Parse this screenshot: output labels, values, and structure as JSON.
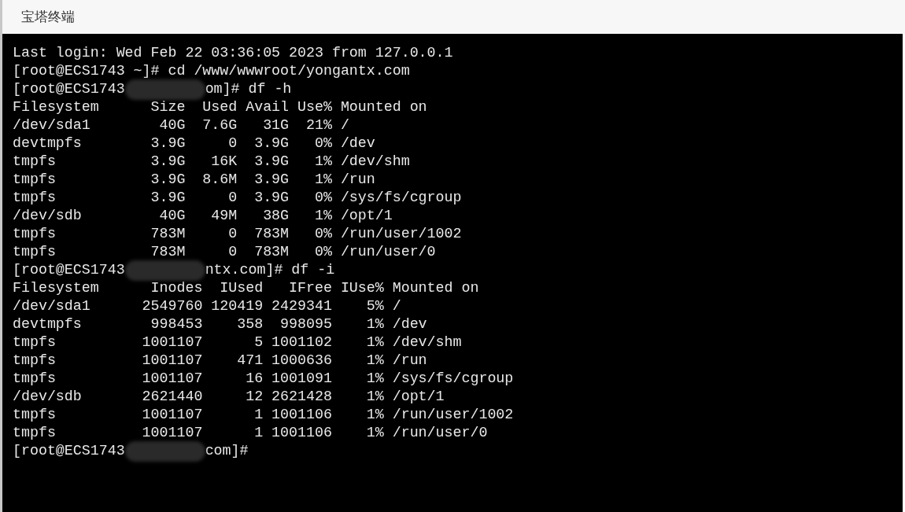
{
  "window": {
    "title": "宝塔终端"
  },
  "terminal": {
    "lines": [
      {
        "kind": "text",
        "text": "Last login: Wed Feb 22 03:36:05 2023 from 127.0.0.1"
      },
      {
        "kind": "text",
        "text": "[root@ECS1743 ~]# cd /www/wwwroot/yongantx.com"
      },
      {
        "kind": "masked",
        "before": "[root@ECS1743",
        "after": "om]# df -h"
      },
      {
        "kind": "text",
        "text": "Filesystem      Size  Used Avail Use% Mounted on"
      },
      {
        "kind": "text",
        "text": "/dev/sda1        40G  7.6G   31G  21% /"
      },
      {
        "kind": "text",
        "text": "devtmpfs        3.9G     0  3.9G   0% /dev"
      },
      {
        "kind": "text",
        "text": "tmpfs           3.9G   16K  3.9G   1% /dev/shm"
      },
      {
        "kind": "text",
        "text": "tmpfs           3.9G  8.6M  3.9G   1% /run"
      },
      {
        "kind": "text",
        "text": "tmpfs           3.9G     0  3.9G   0% /sys/fs/cgroup"
      },
      {
        "kind": "text",
        "text": "/dev/sdb         40G   49M   38G   1% /opt/1"
      },
      {
        "kind": "text",
        "text": "tmpfs           783M     0  783M   0% /run/user/1002"
      },
      {
        "kind": "text",
        "text": "tmpfs           783M     0  783M   0% /run/user/0"
      },
      {
        "kind": "masked",
        "before": "[root@ECS1743",
        "after": "ntx.com]# df -i"
      },
      {
        "kind": "text",
        "text": "Filesystem      Inodes  IUsed   IFree IUse% Mounted on"
      },
      {
        "kind": "text",
        "text": "/dev/sda1      2549760 120419 2429341    5% /"
      },
      {
        "kind": "text",
        "text": "devtmpfs        998453    358  998095    1% /dev"
      },
      {
        "kind": "text",
        "text": "tmpfs          1001107      5 1001102    1% /dev/shm"
      },
      {
        "kind": "text",
        "text": "tmpfs          1001107    471 1000636    1% /run"
      },
      {
        "kind": "text",
        "text": "tmpfs          1001107     16 1001091    1% /sys/fs/cgroup"
      },
      {
        "kind": "text",
        "text": "/dev/sdb       2621440     12 2621428    1% /opt/1"
      },
      {
        "kind": "text",
        "text": "tmpfs          1001107      1 1001106    1% /run/user/1002"
      },
      {
        "kind": "text",
        "text": "tmpfs          1001107      1 1001106    1% /run/user/0"
      },
      {
        "kind": "masked",
        "before": "[root@ECS1743",
        "after": "com]#"
      }
    ]
  }
}
